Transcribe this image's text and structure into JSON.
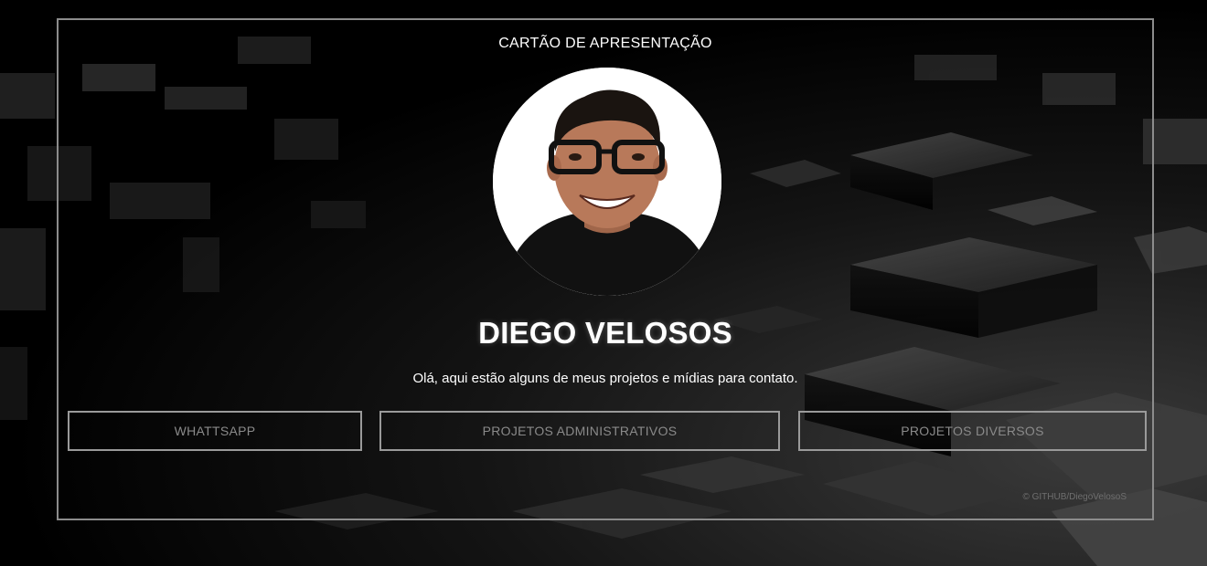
{
  "card": {
    "title": "CARTÃO DE APRESENTAÇÃO",
    "name": "DIEGO VELOSOS",
    "intro": "Olá, aqui estão alguns de meus projetos e mídias para contato."
  },
  "buttons": {
    "whatsapp": "WHATTSAPP",
    "admin": "PROJETOS ADMINISTRATIVOS",
    "diversos": "PROJETOS DIVERSOS"
  },
  "footer": {
    "copyright": "© GITHUB/DiegoVelosoS"
  },
  "colors": {
    "background": "#000000",
    "card_border": "#8c8c8c",
    "button_border": "#9a9a9a",
    "button_text": "#8a8a8a",
    "text": "#ffffff"
  }
}
